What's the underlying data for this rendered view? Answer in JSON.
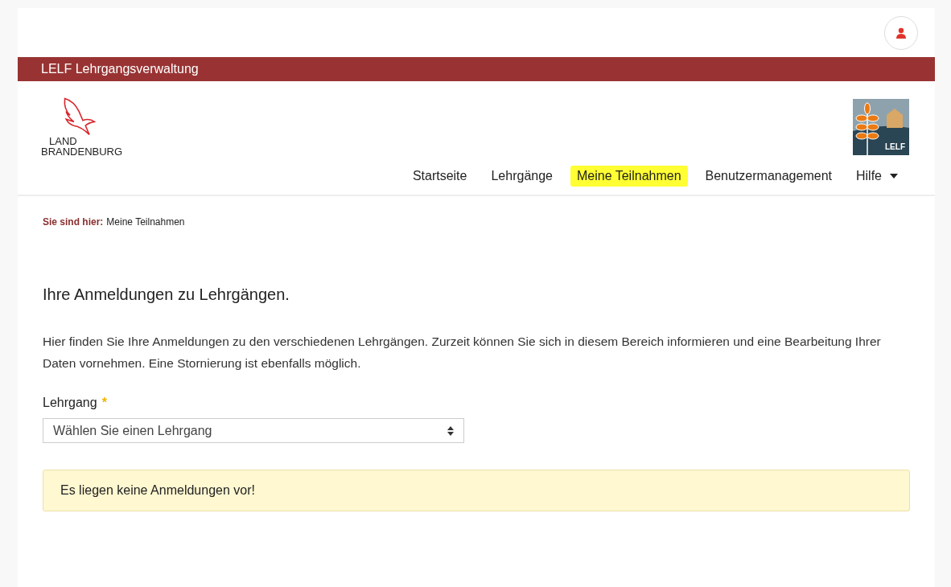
{
  "app_bar": {
    "title": "LELF Lehrgangsverwaltung"
  },
  "logos": {
    "left_text_lines": [
      "LAND",
      "BRANDENBURG"
    ],
    "right_text": "LELF"
  },
  "nav": [
    {
      "label": "Startseite",
      "selected": false,
      "has_caret": false
    },
    {
      "label": "Lehrgänge",
      "selected": false,
      "has_caret": false
    },
    {
      "label": "Meine Teilnahmen",
      "selected": true,
      "has_caret": false
    },
    {
      "label": "Benutzermanagement",
      "selected": false,
      "has_caret": false
    },
    {
      "label": "Hilfe",
      "selected": false,
      "has_caret": true
    }
  ],
  "breadcrumb": {
    "prefix": "Sie sind hier:",
    "current": "Meine Teilnahmen"
  },
  "heading": "Ihre Anmeldungen zu Lehrgängen.",
  "intro": "Hier finden Sie Ihre Anmeldungen zu den verschiedenen Lehrgängen. Zurzeit können Sie sich in diesem Bereich informieren und eine Bearbeitung Ihrer Daten vornehmen. Eine Stornierung ist ebenfalls möglich.",
  "field": {
    "label": "Lehrgang",
    "required_mark": "*",
    "placeholder": "Wählen Sie einen Lehrgang"
  },
  "alert": {
    "kind": "warning",
    "text": "Es liegen keine Anmeldungen vor!"
  }
}
